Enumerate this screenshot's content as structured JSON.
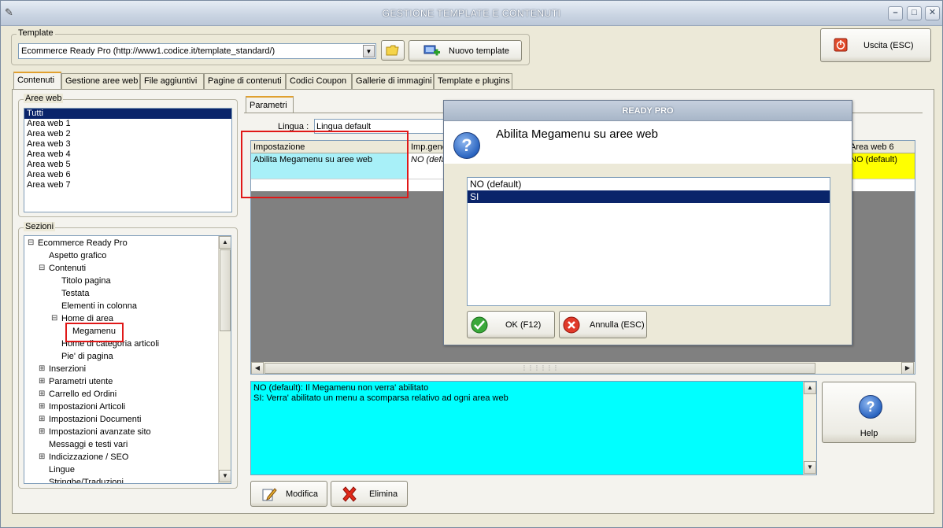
{
  "window": {
    "title": "GESTIONE TEMPLATE E CONTENUTI"
  },
  "template": {
    "group_label": "Template",
    "selected": "Ecommerce Ready Pro (http://www1.codice.it/template_standard/)",
    "new_button": "Nuovo template"
  },
  "exit_button": "Uscita (ESC)",
  "tabs": [
    {
      "label": "Contenuti"
    },
    {
      "label": "Gestione aree web"
    },
    {
      "label": "File aggiuntivi"
    },
    {
      "label": "Pagine di contenuti"
    },
    {
      "label": "Codici Coupon"
    },
    {
      "label": "Gallerie di immagini"
    },
    {
      "label": "Template e plugins"
    }
  ],
  "aree_web": {
    "label": "Aree web",
    "items": [
      "Tutti",
      "Area web 1",
      "Area web 2",
      "Area web 3",
      "Area web 4",
      "Area web 5",
      "Area web 6",
      "Area web 7"
    ]
  },
  "sezioni": {
    "label": "Sezioni",
    "items": [
      {
        "label": "Ecommerce Ready Pro",
        "expander": "⊟"
      },
      {
        "label": "Aspetto grafico",
        "expander": ""
      },
      {
        "label": "Contenuti",
        "expander": "⊟"
      },
      {
        "label": "Titolo pagina",
        "expander": ""
      },
      {
        "label": "Testata",
        "expander": ""
      },
      {
        "label": "Elementi in colonna",
        "expander": ""
      },
      {
        "label": "Home di area",
        "expander": "⊟"
      },
      {
        "label": "Megamenu",
        "expander": ""
      },
      {
        "label": "Home di categoria articoli",
        "expander": ""
      },
      {
        "label": "Pie' di pagina",
        "expander": ""
      },
      {
        "label": "Inserzioni",
        "expander": "⊞"
      },
      {
        "label": "Parametri utente",
        "expander": "⊞"
      },
      {
        "label": "Carrello ed Ordini",
        "expander": "⊞"
      },
      {
        "label": "Impostazioni Articoli",
        "expander": "⊞"
      },
      {
        "label": "Impostazioni Documenti",
        "expander": "⊞"
      },
      {
        "label": "Impostazioni avanzate sito",
        "expander": "⊞"
      },
      {
        "label": "Messaggi e testi vari",
        "expander": ""
      },
      {
        "label": "Indicizzazione / SEO",
        "expander": "⊞"
      },
      {
        "label": "Lingue",
        "expander": ""
      },
      {
        "label": "Stringhe/Traduzioni",
        "expander": ""
      }
    ]
  },
  "parametri": {
    "tab_label": "Parametri",
    "lingua_label": "Lingua :",
    "lingua_value": "Lingua default",
    "columns": [
      "Impostazione",
      "Imp.gene",
      "Area web 6"
    ],
    "row": {
      "impostazione": "Abilita Megamenu su aree web",
      "imp_generale": "NO (default)",
      "area_web_6": "NO (default)"
    }
  },
  "description": {
    "line1": "NO (default): Il Megamenu non verra' abilitato",
    "line2": "SI: Verra' abilitato un menu a scomparsa relativo ad ogni area web"
  },
  "buttons": {
    "modifica": "Modifica",
    "elimina": "Elimina",
    "help": "Help"
  },
  "dialog": {
    "title": "READY PRO",
    "heading": "Abilita Megamenu su aree web",
    "options": [
      "NO (default)",
      "SI"
    ],
    "selected_index": 1,
    "ok": "OK (F12)",
    "cancel": "Annulla (ESC)"
  },
  "colors": {
    "selection": "#0a246a",
    "memo": "#00ffff",
    "highlight_cell": "#ffff00",
    "row_cell": "#a8f0f8",
    "annotation": "#e01818"
  }
}
